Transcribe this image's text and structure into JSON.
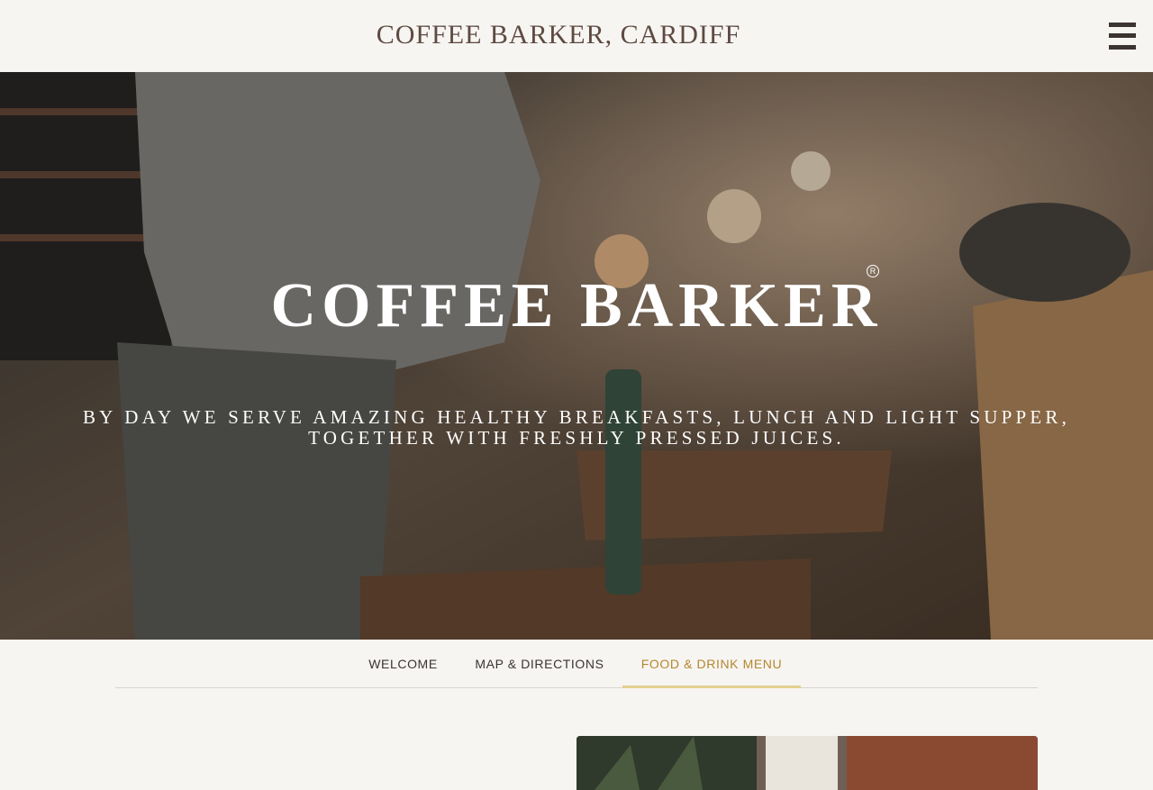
{
  "header": {
    "title": "COFFEE BARKER, CARDIFF",
    "menu_icon": "hamburger-menu-icon"
  },
  "hero": {
    "logo": "COFFEE BARKER",
    "registered_mark": "R",
    "tagline_line1": "BY DAY WE SERVE AMAZING HEALTHY BREAKFASTS, LUNCH AND LIGHT SUPPER,",
    "tagline_line2": "TOGETHER WITH FRESHLY PRESSED JUICES."
  },
  "tabs": [
    {
      "label": "WELCOME",
      "active": false
    },
    {
      "label": "MAP & DIRECTIONS",
      "active": false
    },
    {
      "label": "FOOD & DRINK MENU",
      "active": true
    }
  ],
  "colors": {
    "accent": "#b3872e",
    "underline": "#e3cf8f",
    "header_text": "#5e4a41",
    "background": "#f7f5f2"
  }
}
